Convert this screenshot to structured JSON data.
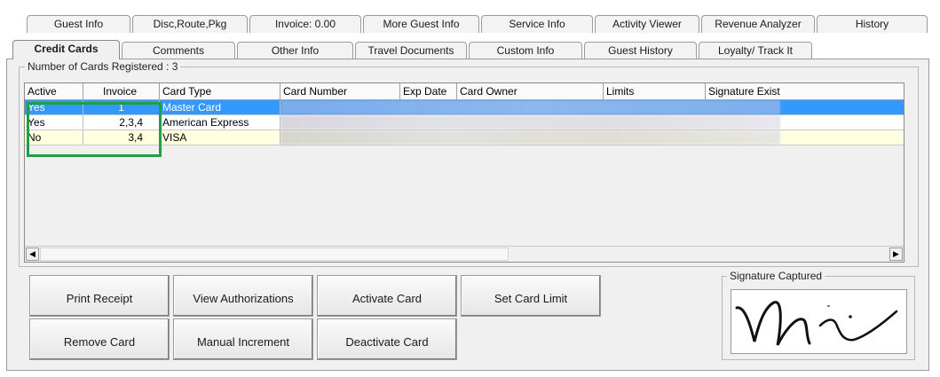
{
  "tabs_row1": [
    {
      "label": "Guest Info"
    },
    {
      "label": "Disc,Route,Pkg"
    },
    {
      "label": "Invoice: 0.00"
    },
    {
      "label": "More Guest Info"
    },
    {
      "label": "Service Info"
    },
    {
      "label": "Activity Viewer"
    },
    {
      "label": "Revenue Analyzer"
    },
    {
      "label": "History"
    }
  ],
  "tabs_row2": [
    {
      "label": "Credit Cards",
      "active": true
    },
    {
      "label": "Comments"
    },
    {
      "label": "Other Info"
    },
    {
      "label": "Travel Documents"
    },
    {
      "label": "Custom Info"
    },
    {
      "label": "Guest History"
    },
    {
      "label": "Loyalty/ Track It"
    }
  ],
  "cards_group": {
    "label": "Number of Cards Registered : 3"
  },
  "grid": {
    "columns": [
      "Active",
      "Invoice",
      "Card Type",
      "Card Number",
      "Exp Date",
      "Card Owner",
      "Limits",
      "Signature Exist"
    ],
    "rows": [
      {
        "active": "Yes",
        "invoice": "1",
        "card_type": "Master Card",
        "selected": true
      },
      {
        "active": "Yes",
        "invoice": "2,3,4",
        "card_type": "American Express"
      },
      {
        "active": "No",
        "invoice": "3,4",
        "card_type": "VISA"
      }
    ]
  },
  "scrollbar": {
    "left_arrow": "◀",
    "right_arrow": "▶"
  },
  "buttons": {
    "print_receipt": "Print Receipt",
    "view_authorizations": "View Authorizations",
    "activate_card": "Activate Card",
    "set_card_limit": "Set Card Limit",
    "remove_card": "Remove Card",
    "manual_increment": "Manual Increment",
    "deactivate_card": "Deactivate Card"
  },
  "signature": {
    "label": "Signature Captured"
  },
  "colors": {
    "selection": "#3399ff",
    "highlight_border": "#1fa043",
    "alt_row": "#ffffe1"
  }
}
